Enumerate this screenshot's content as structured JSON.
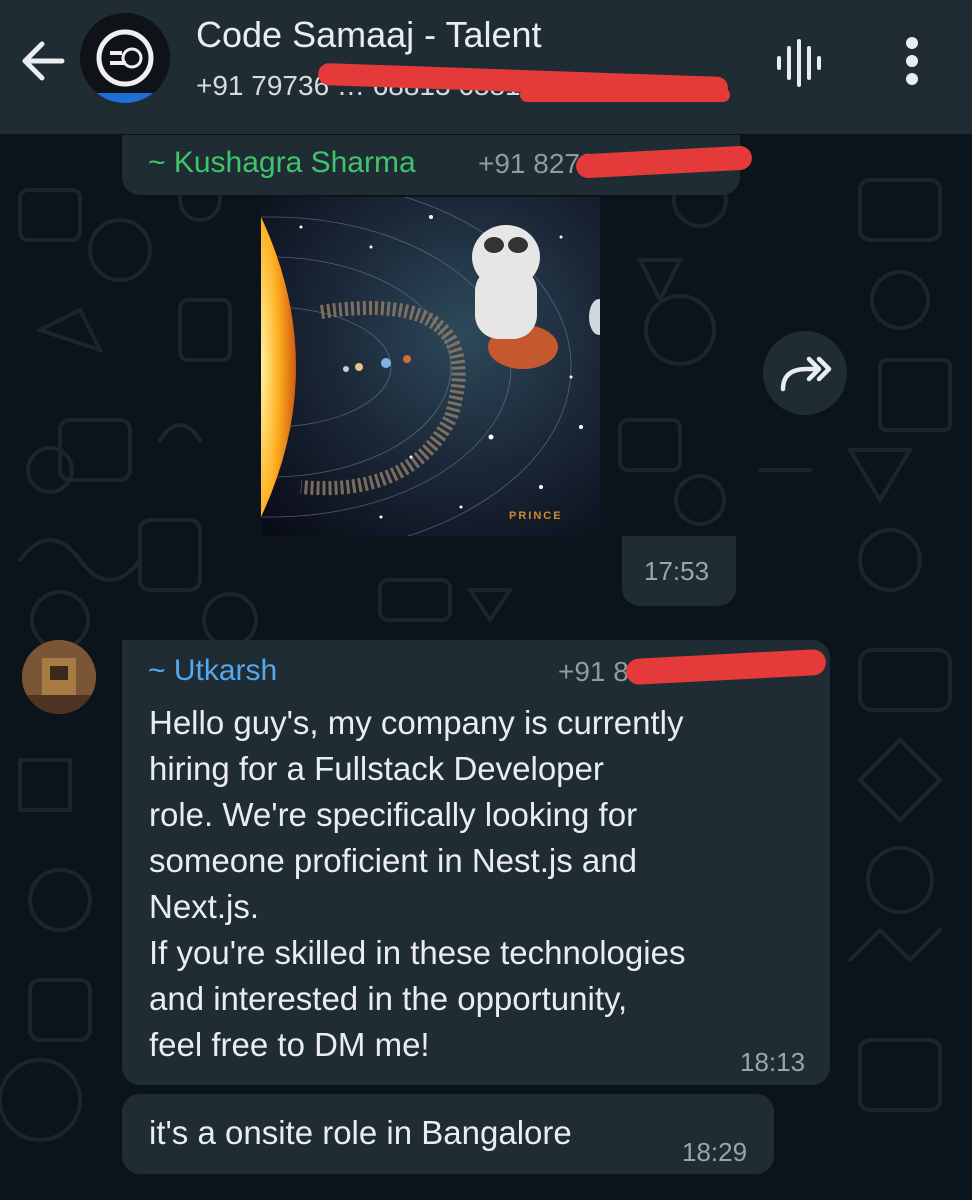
{
  "header": {
    "title": "Code Samaaj - Talent",
    "subtitle": "+91 79736 … 68813 6881…"
  },
  "messages": [
    {
      "sender": "~ Kushagra Sharma",
      "phone": "+91 8279",
      "image_caption": "PRINCE",
      "time": "17:53"
    },
    {
      "sender": "~ Utkarsh",
      "phone": "+91 8",
      "lines": [
        "Hello guy's, my company is currently",
        "hiring for a Fullstack Developer",
        "role. We're specifically looking for",
        "someone proficient in Nest.js and",
        "Next.js.",
        "If you're skilled in these technologies",
        "and interested in the opportunity,",
        "feel free to DM me!"
      ],
      "time": "18:13"
    },
    {
      "text": "it's a onsite role in Bangalore",
      "time": "18:29"
    }
  ],
  "colors": {
    "header_bg": "#1f2c34",
    "chat_bg": "#0b141a",
    "bubble_bg": "#202c33",
    "sender1": "#3ec46a",
    "sender2": "#53a8f0",
    "redaction": "#e43a3a"
  }
}
